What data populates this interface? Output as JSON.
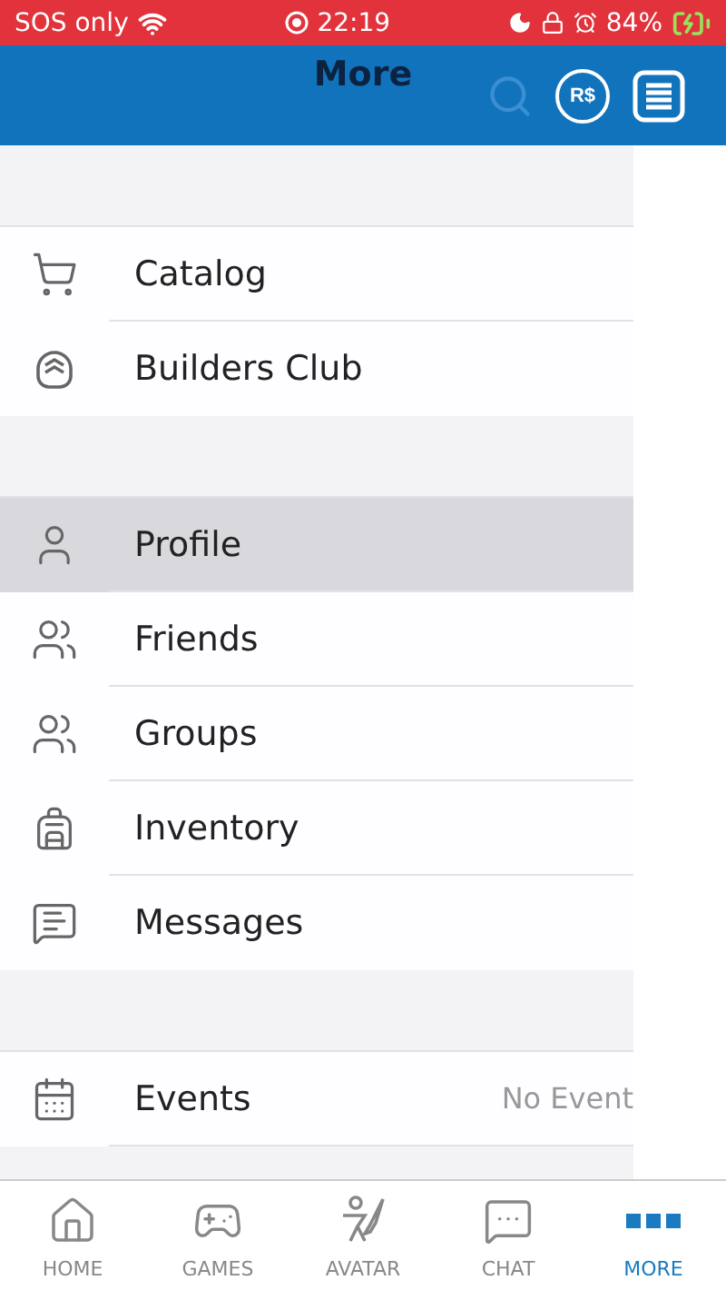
{
  "status_bar": {
    "carrier": "SOS only",
    "time": "22:19",
    "battery": "84%"
  },
  "header": {
    "title": "More",
    "currency": "R$"
  },
  "sections": [
    {
      "items": [
        {
          "kind": "catalog",
          "label": "Catalog",
          "selected": false
        },
        {
          "kind": "builders",
          "label": "Builders Club",
          "selected": false
        }
      ]
    },
    {
      "items": [
        {
          "kind": "profile",
          "label": "Profile",
          "selected": true
        },
        {
          "kind": "friends",
          "label": "Friends",
          "selected": false
        },
        {
          "kind": "groups",
          "label": "Groups",
          "selected": false
        },
        {
          "kind": "inventory",
          "label": "Inventory",
          "selected": false
        },
        {
          "kind": "messages",
          "label": "Messages",
          "selected": false
        }
      ]
    },
    {
      "items": [
        {
          "kind": "events",
          "label": "Events",
          "selected": false,
          "detail": "No Event"
        }
      ]
    }
  ],
  "tabs": [
    {
      "kind": "home",
      "label": "HOME",
      "selected": false
    },
    {
      "kind": "games",
      "label": "GAMES",
      "selected": false
    },
    {
      "kind": "avatar",
      "label": "AVATAR",
      "selected": false
    },
    {
      "kind": "chat",
      "label": "CHAT",
      "selected": false
    },
    {
      "kind": "more",
      "label": "MORE",
      "selected": true
    }
  ]
}
